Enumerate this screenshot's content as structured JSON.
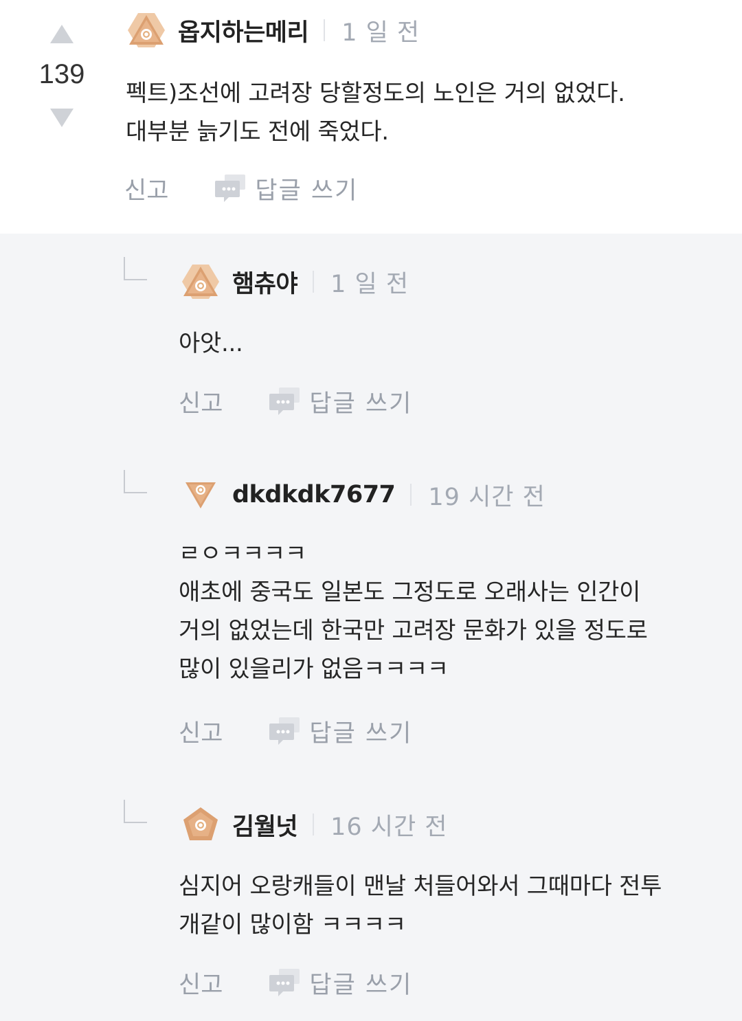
{
  "main_comment": {
    "vote_count": "139",
    "badge": "bronze-triangle-badge-icon",
    "nickname": "옵지하는메리",
    "time": "1 일 전",
    "lines": [
      "펙트)조선에 고려장 당할정도의 노인은 거의 없었다.",
      "대부분 늙기도 전에 죽었다."
    ],
    "report_label": "신고",
    "reply_label": "답글 쓰기"
  },
  "replies": [
    {
      "badge": "bronze-triangle-badge-icon",
      "nickname": "햄츄야",
      "time": "1 일 전",
      "lines": [
        "아앗..."
      ],
      "report_label": "신고",
      "reply_label": "답글 쓰기"
    },
    {
      "badge": "bronze-inverted-triangle-badge-icon",
      "nickname": "dkdkdk7677",
      "time": "19 시간 전",
      "lines": [
        "ㄹㅇㅋㅋㅋㅋ",
        "애초에 중국도 일본도 그정도로 오래사는 인간이",
        "거의 없었는데 한국만 고려장 문화가 있을 정도로",
        "많이 있을리가 없음ㅋㅋㅋㅋ"
      ],
      "report_label": "신고",
      "reply_label": "답글 쓰기"
    },
    {
      "badge": "bronze-pentagon-badge-icon",
      "nickname": "김월넛",
      "time": "16 시간 전",
      "lines": [
        "심지어 오랑캐들이 맨날 처들어와서 그때마다 전투",
        "개같이 많이함 ㅋㅋㅋㅋ"
      ],
      "report_label": "신고",
      "reply_label": "답글 쓰기"
    }
  ],
  "colors": {
    "reply_background": "#f4f5f7",
    "badge_bronze": "#e0a878",
    "muted_text": "#9aa0aa"
  }
}
